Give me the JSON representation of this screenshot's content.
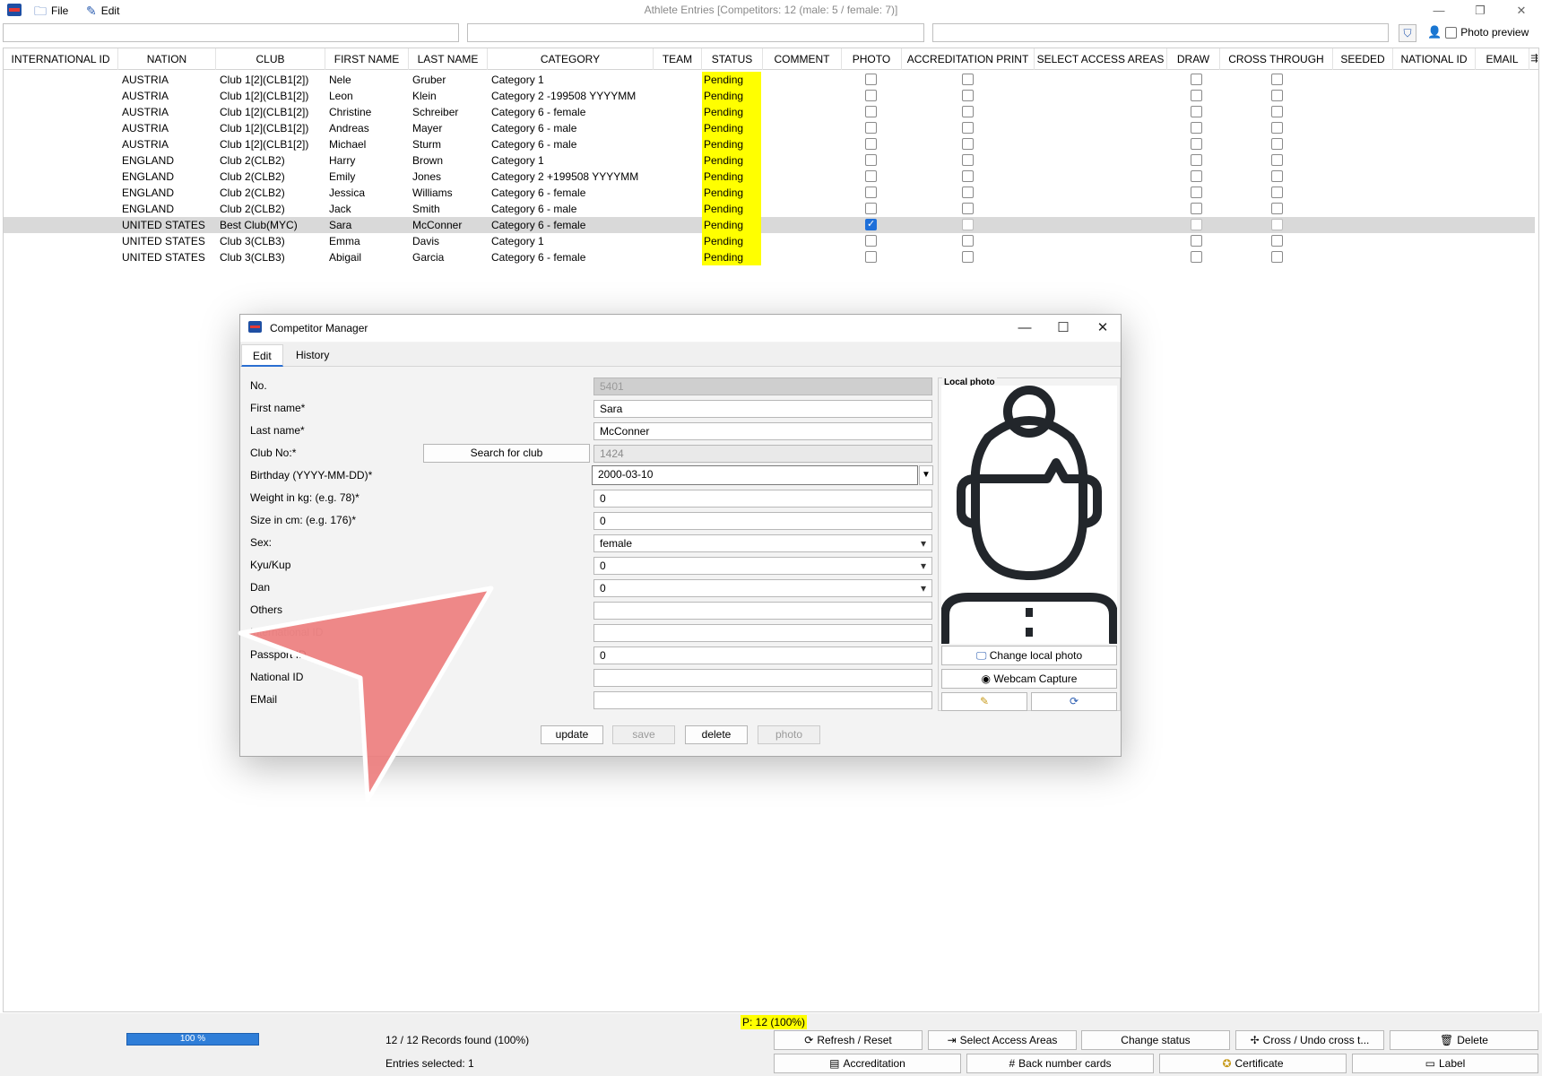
{
  "window": {
    "title": "Athlete Entries [Competitors: 12 (male: 5 / female: 7)]",
    "menu": [
      {
        "label": "File",
        "icon": "folder-icon"
      },
      {
        "label": "Edit",
        "icon": "edit-icon"
      }
    ],
    "controls": {
      "minimize": "—",
      "restore": "❐",
      "close": "✕"
    }
  },
  "toolbar": {
    "photo_preview_label": "Photo preview",
    "photo_preview_checked": false
  },
  "grid": {
    "columns": [
      "INTERNATIONAL ID",
      "NATION",
      "CLUB",
      "FIRST NAME",
      "LAST NAME",
      "CATEGORY",
      "TEAM",
      "STATUS",
      "COMMENT",
      "PHOTO",
      "ACCREDITATION PRINT",
      "SELECT ACCESS AREAS",
      "DRAW",
      "CROSS THROUGH",
      "SEEDED",
      "NATIONAL ID",
      "EMAIL"
    ],
    "rows": [
      {
        "nation": "AUSTRIA",
        "club": "Club 1[2](CLB1[2])",
        "first": "Nele",
        "last": "Gruber",
        "category": "Category 1",
        "status": "Pending",
        "photo": false,
        "selected": false
      },
      {
        "nation": "AUSTRIA",
        "club": "Club 1[2](CLB1[2])",
        "first": "Leon",
        "last": "Klein",
        "category": "Category 2 -199508 YYYYMM",
        "status": "Pending",
        "photo": false,
        "selected": false
      },
      {
        "nation": "AUSTRIA",
        "club": "Club 1[2](CLB1[2])",
        "first": "Christine",
        "last": "Schreiber",
        "category": "Category 6 - female",
        "status": "Pending",
        "photo": false,
        "selected": false
      },
      {
        "nation": "AUSTRIA",
        "club": "Club 1[2](CLB1[2])",
        "first": "Andreas",
        "last": "Mayer",
        "category": "Category 6 - male",
        "status": "Pending",
        "photo": false,
        "selected": false
      },
      {
        "nation": "AUSTRIA",
        "club": "Club 1[2](CLB1[2])",
        "first": "Michael",
        "last": "Sturm",
        "category": "Category 6 - male",
        "status": "Pending",
        "photo": false,
        "selected": false
      },
      {
        "nation": "ENGLAND",
        "club": "Club 2(CLB2)",
        "first": "Harry",
        "last": "Brown",
        "category": "Category 1",
        "status": "Pending",
        "photo": false,
        "selected": false
      },
      {
        "nation": "ENGLAND",
        "club": "Club 2(CLB2)",
        "first": "Emily",
        "last": "Jones",
        "category": "Category 2 +199508 YYYYMM",
        "status": "Pending",
        "photo": false,
        "selected": false
      },
      {
        "nation": "ENGLAND",
        "club": "Club 2(CLB2)",
        "first": "Jessica",
        "last": "Williams",
        "category": "Category 6 - female",
        "status": "Pending",
        "photo": false,
        "selected": false
      },
      {
        "nation": "ENGLAND",
        "club": "Club 2(CLB2)",
        "first": "Jack",
        "last": "Smith",
        "category": "Category 6 - male",
        "status": "Pending",
        "photo": false,
        "selected": false
      },
      {
        "nation": "UNITED STATES",
        "club": "Best Club(MYC)",
        "first": "Sara",
        "last": "McConner",
        "category": "Category 6 - female",
        "status": "Pending",
        "photo": true,
        "selected": true
      },
      {
        "nation": "UNITED STATES",
        "club": "Club 3(CLB3)",
        "first": "Emma",
        "last": "Davis",
        "category": "Category 1",
        "status": "Pending",
        "photo": false,
        "selected": false
      },
      {
        "nation": "UNITED STATES",
        "club": "Club 3(CLB3)",
        "first": "Abigail",
        "last": "Garcia",
        "category": "Category 6 - female",
        "status": "Pending",
        "photo": false,
        "selected": false
      }
    ]
  },
  "dialog": {
    "title": "Competitor Manager",
    "tabs": [
      "Edit",
      "History"
    ],
    "active_tab": "Edit",
    "fields": {
      "no_label": "No.",
      "no_value": "5401",
      "first_label": "First name*",
      "first_value": "Sara",
      "last_label": "Last name*",
      "last_value": "McConner",
      "club_label": "Club No:*",
      "club_search": "Search for club",
      "club_value": "1424",
      "birthday_label": "Birthday (YYYY-MM-DD)*",
      "birthday_value": "2000-03-10",
      "weight_label": "Weight in kg: (e.g. 78)*",
      "weight_value": "0",
      "size_label": "Size in cm: (e.g. 176)*",
      "size_value": "0",
      "sex_label": "Sex:",
      "sex_value": "female",
      "kyu_label": "Kyu/Kup",
      "kyu_value": "0",
      "dan_label": "Dan",
      "dan_value": "0",
      "others_label": "Others",
      "others_value": "",
      "intl_label": "International ID",
      "intl_value": "",
      "passport_label": "Passport ID",
      "passport_value": "0",
      "national_label": "National ID",
      "national_value": "",
      "email_label": "EMail",
      "email_value": ""
    },
    "photo": {
      "panel_title": "Local photo",
      "change_label": "Change local photo",
      "webcam_label": "Webcam Capture"
    },
    "buttons": {
      "update": "update",
      "save": "save",
      "delete": "delete",
      "photo": "photo"
    }
  },
  "statusbar": {
    "p_badge": "P: 12 (100%)",
    "progress_label": "100 %",
    "progress_value": 1.0,
    "records_found": "12 / 12 Records found (100%)",
    "entries_selected": "Entries selected: 1",
    "buttons_row1": [
      "Refresh / Reset",
      "Select Access Areas",
      "Change status",
      "Cross / Undo cross t...",
      "Delete"
    ],
    "buttons_row2": [
      "Accreditation",
      "Back number cards",
      "Certificate",
      "Label"
    ]
  },
  "colors": {
    "status_highlight": "#ffff00",
    "selected_row": "#d9d9d9",
    "progress": "#2f7ed8",
    "cursor_arrow": "#ee7f7f"
  }
}
